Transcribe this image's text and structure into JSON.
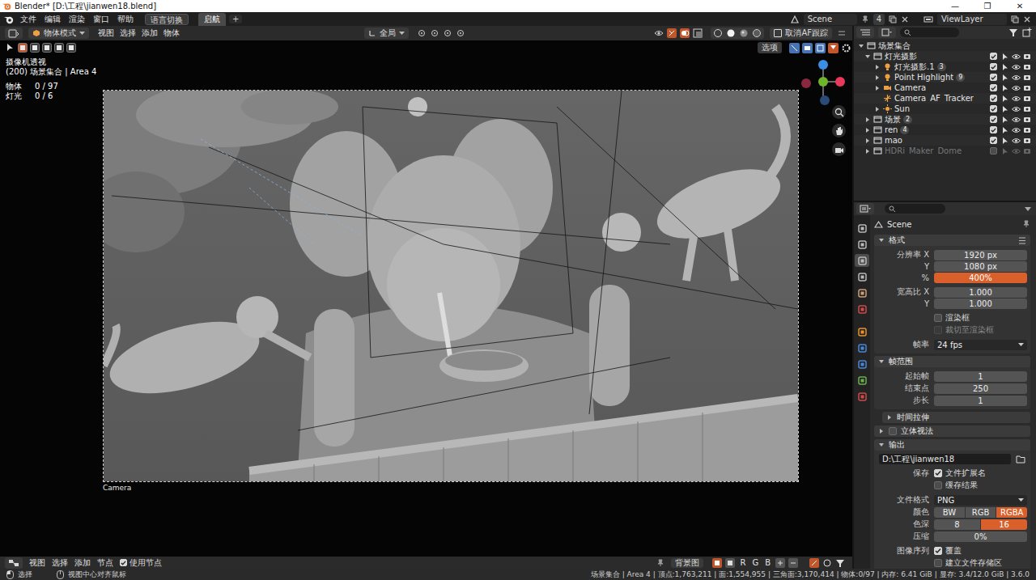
{
  "window": {
    "title": "Blender* [D:\\工程\\jianwen18.blend]",
    "controls": [
      "—",
      "❐",
      "✕"
    ]
  },
  "topbar": {
    "menus": [
      "文件",
      "编辑",
      "渲染",
      "窗口",
      "帮助"
    ],
    "language_button": "语言切换",
    "workspaces": [
      {
        "label": "启航",
        "selected": true
      }
    ],
    "add_workspace": "+",
    "scene": "Scene",
    "scene_users": "4",
    "view_layer": "ViewLayer"
  },
  "viewport": {
    "mode": "物体模式",
    "menus": [
      "视图",
      "选择",
      "添加",
      "物体"
    ],
    "orientation": "全局",
    "af_button": "取消AF跟踪",
    "options_button": "选项",
    "overlay_lines": [
      "摄像机透视",
      "(200) 场景集合 | Area 4"
    ],
    "stats": [
      {
        "label": "物体",
        "value": "0 / 97"
      },
      {
        "label": "灯光",
        "value": "0 / 6"
      }
    ],
    "camera_label": "Camera"
  },
  "outliner": {
    "root": "场景集合",
    "items": [
      {
        "label": "灯光摄影",
        "kind": "collection",
        "depth": 0,
        "has_children": true,
        "expanded": true,
        "checked": true,
        "disabled": false
      },
      {
        "label": "灯光摄影.1",
        "kind": "light",
        "depth": 1,
        "has_children": true,
        "expanded": false,
        "checked": true,
        "disabled": false,
        "badge": "3"
      },
      {
        "label": "Point Highlight",
        "kind": "light",
        "depth": 1,
        "has_children": true,
        "expanded": false,
        "checked": true,
        "disabled": false,
        "badge": "9"
      },
      {
        "label": "Camera",
        "kind": "camera",
        "depth": 1,
        "has_children": true,
        "expanded": false,
        "checked": true,
        "disabled": false
      },
      {
        "label": "Camera_AF_Tracker",
        "kind": "empty",
        "depth": 1,
        "has_children": false,
        "expanded": false,
        "checked": true,
        "disabled": false
      },
      {
        "label": "Sun",
        "kind": "sun",
        "depth": 1,
        "has_children": true,
        "expanded": false,
        "checked": true,
        "disabled": false
      },
      {
        "label": "场景",
        "kind": "collection",
        "depth": 0,
        "has_children": true,
        "expanded": false,
        "checked": true,
        "disabled": false,
        "badge": "2"
      },
      {
        "label": "ren",
        "kind": "collection",
        "depth": 0,
        "has_children": true,
        "expanded": false,
        "checked": true,
        "disabled": false,
        "badge": "4"
      },
      {
        "label": "mao",
        "kind": "collection",
        "depth": 0,
        "has_children": true,
        "expanded": false,
        "checked": true,
        "disabled": false
      },
      {
        "label": "HDRi_Maker_Dome",
        "kind": "collection",
        "depth": 0,
        "has_children": true,
        "expanded": false,
        "checked": false,
        "disabled": true
      }
    ]
  },
  "properties": {
    "context": "Scene",
    "tabs": [
      {
        "color": "#b8b8b8",
        "selected": false
      },
      {
        "color": "#b8b8b8",
        "selected": false
      },
      {
        "color": "#b8b8b8",
        "selected": true
      },
      {
        "color": "#b8b8b8",
        "selected": false
      },
      {
        "color": "#c9a07a",
        "selected": false
      },
      {
        "color": "#d04a4a",
        "selected": false
      },
      {
        "color": "#e8922e",
        "selected": false
      },
      {
        "color": "#4a86d8",
        "selected": false
      },
      {
        "color": "#4a86d8",
        "selected": false
      },
      {
        "color": "#68b050",
        "selected": false
      },
      {
        "color": "#d04a4a",
        "selected": false
      }
    ],
    "sections": [
      {
        "title": "格式",
        "expanded": true,
        "nested": false,
        "groups": [
          [
            {
              "kind": "number",
              "label": "分辨率 X",
              "value": "1920 px",
              "highlighted": false
            },
            {
              "kind": "number",
              "label": "Y",
              "value": "1080 px",
              "highlighted": false
            },
            {
              "kind": "number",
              "label": "%",
              "value": "400%",
              "highlighted": true
            }
          ],
          [
            {
              "kind": "number",
              "label": "宽高比 X",
              "value": "1.000",
              "highlighted": false
            },
            {
              "kind": "number",
              "label": "Y",
              "value": "1.000",
              "highlighted": false
            }
          ],
          [
            {
              "kind": "checkbox",
              "label": "",
              "text": "渲染框",
              "checked": false,
              "disabled": false
            },
            {
              "kind": "checkbox",
              "label": "",
              "text": "裁切至渲染框",
              "checked": false,
              "disabled": true
            }
          ],
          [
            {
              "kind": "dropdown",
              "label": "帧率",
              "value": "24 fps"
            }
          ]
        ]
      },
      {
        "title": "帧范围",
        "expanded": true,
        "nested": false,
        "groups": [
          [
            {
              "kind": "number",
              "label": "起始帧",
              "value": "1",
              "highlighted": false
            },
            {
              "kind": "number",
              "label": "结束点",
              "value": "250",
              "highlighted": false
            },
            {
              "kind": "number",
              "label": "步长",
              "value": "1",
              "highlighted": false
            }
          ]
        ]
      },
      {
        "title": "时间拉伸",
        "expanded": false,
        "nested": true,
        "groups": []
      },
      {
        "title": "立体视法",
        "expanded": false,
        "nested": false,
        "toggle": {
          "checked": false
        },
        "groups": []
      },
      {
        "title": "输出",
        "expanded": true,
        "nested": false,
        "groups": [
          [
            {
              "kind": "path",
              "value": "D:\\工程\\jianwen18"
            }
          ],
          [
            {
              "kind": "checkbox",
              "label": "保存",
              "text": "文件扩展名",
              "checked": true,
              "disabled": false
            },
            {
              "kind": "checkbox",
              "label": "",
              "text": "缓存结果",
              "checked": false,
              "disabled": false
            }
          ],
          [
            {
              "kind": "dropdown",
              "label": "文件格式",
              "value": "PNG"
            },
            {
              "kind": "toggle",
              "label": "颜色",
              "options": [
                {
                  "label": "BW",
                  "selected": false
                },
                {
                  "label": "RGB",
                  "selected": false
                },
                {
                  "label": "RGBA",
                  "selected": true
                }
              ]
            },
            {
              "kind": "toggle",
              "label": "色深",
              "options": [
                {
                  "label": "8",
                  "selected": false
                },
                {
                  "label": "16",
                  "selected": true
                }
              ]
            },
            {
              "kind": "number",
              "label": "压缩",
              "value": "0%",
              "highlighted": false
            }
          ],
          [
            {
              "kind": "checkbox",
              "label": "图像序列",
              "text": "覆盖",
              "checked": true,
              "disabled": false
            },
            {
              "kind": "checkbox",
              "label": "",
              "text": "建立文件存储区",
              "checked": false,
              "disabled": false
            }
          ]
        ]
      }
    ]
  },
  "node_header": {
    "menus": [
      "视图",
      "选择",
      "添加",
      "节点"
    ],
    "use_nodes": {
      "label": "使用节点",
      "checked": true
    },
    "backdrop_button": "背景图",
    "channels": [
      "R",
      "G",
      "B"
    ]
  },
  "status_bar": {
    "hints": [
      "选择",
      "视图中心对齐鼠标"
    ],
    "stats": "场景集合 | Area 4 | 顶点:1,763,211 | 面:1,554,955 | 三角面:3,170,414 | 物体:0/97 | 内存: 6.41 GiB | 显存: 3.4/12.0 GiB | 3.6.0"
  }
}
